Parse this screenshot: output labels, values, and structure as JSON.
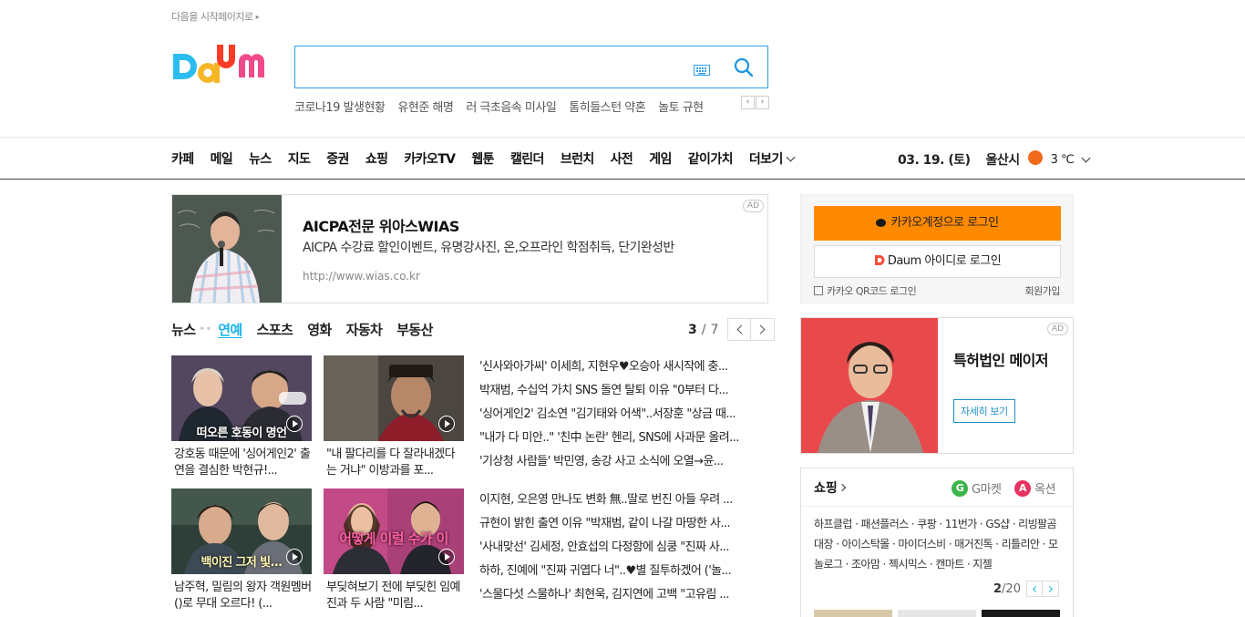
{
  "top": {
    "set_home": "다음을 시작페이지로"
  },
  "search": {
    "placeholder": "",
    "value": ""
  },
  "trends": [
    "코로나19 발생현황",
    "유현준 해명",
    "러 극초음속 미사일",
    "톰히들스턴 약혼",
    "놀토 규현"
  ],
  "gnb": {
    "items": [
      "카페",
      "메일",
      "뉴스",
      "지도",
      "증권",
      "쇼핑",
      "카카오TV",
      "웹툰",
      "캘린더",
      "브런치",
      "사전",
      "게임",
      "같이가치"
    ],
    "more": "더보기"
  },
  "weather": {
    "date": "03. 19. (토)",
    "city": "울산시",
    "temp": "3 ℃"
  },
  "ad_banner": {
    "title": "AICPA전문 위아스WIAS",
    "desc": "AICPA 수강료 할인이벤트, 유명강사진, 온,오프라인 학점취득, 단기완성반",
    "url": "http://www.wias.co.kr",
    "badge": "AD"
  },
  "news": {
    "tabs": [
      "뉴스",
      "연예",
      "스포츠",
      "영화",
      "자동차",
      "부동산"
    ],
    "dots": "••",
    "page_current": "3",
    "page_sep": "/",
    "page_total": "7",
    "cards": [
      {
        "caption": "강호동 때문에 '싱어게인2' 출연을 결심한 박현규!...",
        "thumb_text": "떠오른 호동이 명언"
      },
      {
        "caption": "\"내 팔다리를 다 잘라내겠다는 거냐\" 이방과를 포...",
        "thumb_text": ""
      },
      {
        "caption": "남주혁, 밀림의 왕자 객원멤버()로 무대 오르다! (...",
        "thumb_text": "백이진 그저 빛..."
      },
      {
        "caption": "부딪혀보기 전에 부딪힌 임예진과 두 사람 \"미림...",
        "thumb_text": "어떻게 이럴 수가 이"
      }
    ],
    "headlines_top": [
      "'신사와아가씨' 이세희, 지현우♥오승아 새시작에 충...",
      "박재범, 수십억 가치 SNS 돌연 탈퇴 이유 \"0부터 다...",
      "'싱어게인2' 김소연 \"김기태와 어색\"..서장훈 \"상금 때...",
      "\"내가 다 미안..\" '친中 논란' 헨리, SNS에 사과문 올려...",
      "'기상청 사람들' 박민영, 송강 사고 소식에 오열→윤..."
    ],
    "headlines_bottom": [
      "이지현, 오은영 만나도 변화 無..딸로 번진 아들 우려 ...",
      "규현이 밝힌 출연 이유 \"박재범, 같이 나갈 마땅한 사...",
      "'사내맞선' 김세정, 안효섭의 다정함에 심쿵 \"진짜 사...",
      "하하, 진예에 \"진짜 귀엽다 너\"..♥별 질투하겠어 ('놀...",
      "'스물다섯 스물하나' 최현욱, 김지연에 고백 \"고유림 ..."
    ]
  },
  "login": {
    "kakao": "카카오계정으로 로그인",
    "daum": "Daum 아이디로 로그인",
    "qr": "카카오 QR코드 로그인",
    "signup": "회원가입"
  },
  "side_ad": {
    "title": "특허법인 메이저",
    "button": "자세히 보기",
    "badge": "AD"
  },
  "shopping": {
    "title": "쇼핑",
    "brand1": "G마켓",
    "brand2": "옥션",
    "links": "하프클럽 · 패션플러스 · 쿠팡 · 11번가 · GS샵 · 리빙팔곰대장 · 아이스탁몰 · 마이더스비 · 매거진톡 · 리틀리안 · 모놀로그 · 조아맘 · 젝시믹스 · 캔마트 · 지젤",
    "page_current": "2",
    "page_total": "/20"
  },
  "colors": {
    "accent": "#18b4e9",
    "kakao": "#ff8a00",
    "search_border": "#2fa0e8"
  }
}
